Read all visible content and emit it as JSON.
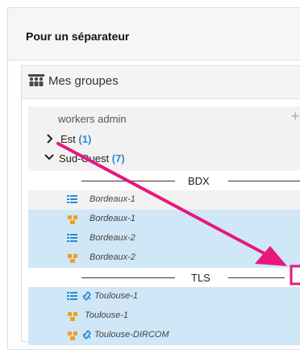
{
  "card": {
    "title": "Pour un séparateur"
  },
  "panel": {
    "title": "Mes groupes"
  },
  "list": {
    "admin_label": "workers admin",
    "add_symbol": "+",
    "folders": [
      {
        "name": "Est",
        "count": "(1)",
        "expanded": false
      },
      {
        "name": "Sud-Ouest",
        "count": "(7)",
        "expanded": true
      }
    ],
    "separators": [
      "BDX",
      "TLS"
    ],
    "items": [
      {
        "label": "Bordeaux-1",
        "icon": "list-icon",
        "linked": false,
        "selected": false
      },
      {
        "label": "Bordeaux-1",
        "icon": "group-puzzle-icon",
        "linked": false,
        "selected": true
      },
      {
        "label": "Bordeaux-2",
        "icon": "list-icon",
        "linked": false,
        "selected": true
      },
      {
        "label": "Bordeaux-2",
        "icon": "group-puzzle-icon",
        "linked": false,
        "selected": true
      },
      {
        "label": "Toulouse-1",
        "icon": "list-icon",
        "linked": true,
        "selected": true
      },
      {
        "label": "Toulouse-1",
        "icon": "group-puzzle-icon",
        "linked": false,
        "selected": true
      },
      {
        "label": "Toulouse-DIRCOM",
        "icon": "group-puzzle-icon",
        "linked": true,
        "selected": true
      }
    ]
  },
  "colors": {
    "accent": "#2a8ad4",
    "selected_row": "#cfe7f7",
    "annotation": "#e8177d",
    "item_icon_orange": "#f0a020"
  }
}
